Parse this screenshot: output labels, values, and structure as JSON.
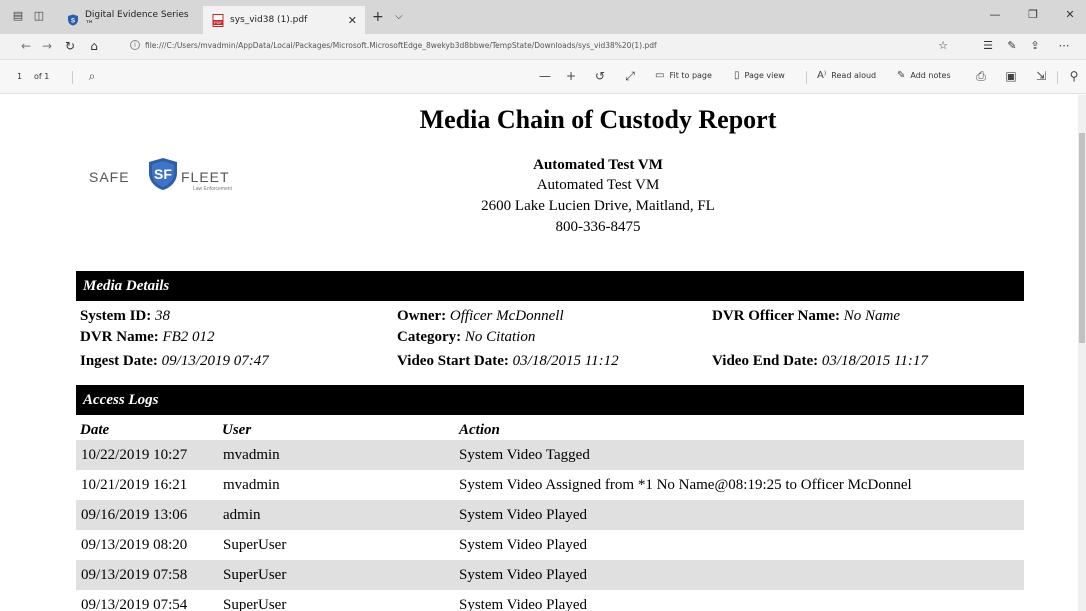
{
  "browser": {
    "tabs": [
      {
        "title": "Digital Evidence Series ™",
        "active": false
      },
      {
        "title": "sys_vid38 (1).pdf",
        "active": true
      }
    ],
    "new_tab": "+",
    "url": "file:///C:/Users/mvadmin/AppData/Local/Packages/Microsoft.MicrosoftEdge_8wekyb3d8bbwe/TempState/Downloads/sys_vid38%20(1).pdf"
  },
  "pdf_toolbar": {
    "page_current": "1",
    "page_total": "of 1",
    "fit_to_page": "Fit to page",
    "page_view": "Page view",
    "read_aloud": "Read aloud",
    "add_notes": "Add notes"
  },
  "report": {
    "title": "Media Chain of Custody Report",
    "logo": {
      "safe": "SAFE",
      "fleet": "FLEET",
      "sub": "Law Enforcement"
    },
    "org": {
      "name": "Automated Test VM",
      "line2": "Automated Test VM",
      "address": "2600 Lake Lucien Drive, Maitland, FL",
      "phone": "800-336-8475"
    },
    "media_details": {
      "heading": "Media Details",
      "system_id": {
        "label": "System ID:",
        "value": "38"
      },
      "owner": {
        "label": "Owner:",
        "value": "Officer McDonnell"
      },
      "dvr_officer": {
        "label": "DVR Officer Name:",
        "value": "No Name"
      },
      "dvr_name": {
        "label": "DVR Name:",
        "value": "FB2 012"
      },
      "category": {
        "label": "Category:",
        "value": "No Citation"
      },
      "ingest_date": {
        "label": "Ingest Date:",
        "value": "09/13/2019 07:47"
      },
      "video_start": {
        "label": "Video Start Date:",
        "value": "03/18/2015 11:12"
      },
      "video_end": {
        "label": "Video End Date:",
        "value": "03/18/2015 11:17"
      }
    },
    "access_logs": {
      "heading": "Access Logs",
      "columns": {
        "date": "Date",
        "user": "User",
        "action": "Action"
      },
      "rows": [
        {
          "date": "10/22/2019 10:27",
          "user": "mvadmin",
          "action": "System Video Tagged"
        },
        {
          "date": "10/21/2019 16:21",
          "user": "mvadmin",
          "action": "System Video Assigned from *1 No Name@08:19:25 to Officer McDonnel"
        },
        {
          "date": "09/16/2019 13:06",
          "user": "admin",
          "action": "System Video Played"
        },
        {
          "date": "09/13/2019 08:20",
          "user": "SuperUser",
          "action": "System Video Played"
        },
        {
          "date": "09/13/2019 07:58",
          "user": "SuperUser",
          "action": "System Video Played"
        },
        {
          "date": "09/13/2019 07:54",
          "user": "SuperUser",
          "action": "System Video Played"
        }
      ]
    }
  }
}
